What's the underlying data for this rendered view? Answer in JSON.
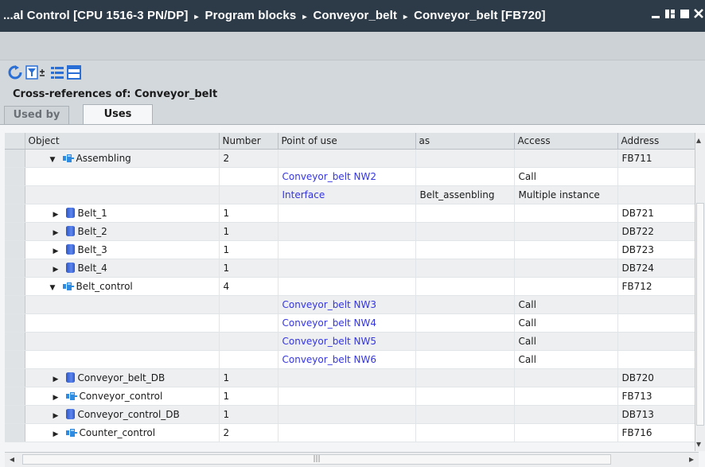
{
  "titlebar": {
    "crumbs": [
      "...al Control [CPU 1516-3 PN/DP]",
      "Program blocks",
      "Conveyor_belt",
      "Conveyor_belt [FB720]"
    ],
    "separator": "▸"
  },
  "toolbar": {
    "icons": [
      "refresh-icon",
      "filter-icon",
      "collapse-icon",
      "layout-icon"
    ]
  },
  "heading": "Cross-references of: Conveyor_belt",
  "tabs": [
    {
      "label": "Used by",
      "active": false
    },
    {
      "label": "Uses",
      "active": true
    }
  ],
  "table": {
    "columns": [
      "Object",
      "Number",
      "Point of use",
      "as",
      "Access",
      "Address"
    ],
    "rows": [
      {
        "kind": "fb",
        "expand": "open",
        "object": "Assembling",
        "number": "2",
        "point": "",
        "as": "",
        "access": "",
        "address": "FB711"
      },
      {
        "kind": "sub",
        "object": "",
        "number": "",
        "point": "Conveyor_belt NW2",
        "as": "",
        "access": "Call",
        "address": ""
      },
      {
        "kind": "sub",
        "object": "",
        "number": "",
        "point": "Interface",
        "as": "Belt_assenbling",
        "access": "Multiple instance",
        "address": ""
      },
      {
        "kind": "db",
        "expand": "closed",
        "object": "Belt_1",
        "number": "1",
        "point": "",
        "as": "",
        "access": "",
        "address": "DB721"
      },
      {
        "kind": "db",
        "expand": "closed",
        "object": "Belt_2",
        "number": "1",
        "point": "",
        "as": "",
        "access": "",
        "address": "DB722"
      },
      {
        "kind": "db",
        "expand": "closed",
        "object": "Belt_3",
        "number": "1",
        "point": "",
        "as": "",
        "access": "",
        "address": "DB723"
      },
      {
        "kind": "db",
        "expand": "closed",
        "object": "Belt_4",
        "number": "1",
        "point": "",
        "as": "",
        "access": "",
        "address": "DB724"
      },
      {
        "kind": "fb",
        "expand": "open",
        "object": "Belt_control",
        "number": "4",
        "point": "",
        "as": "",
        "access": "",
        "address": "FB712"
      },
      {
        "kind": "sub",
        "object": "",
        "number": "",
        "point": "Conveyor_belt NW3",
        "as": "",
        "access": "Call",
        "address": ""
      },
      {
        "kind": "sub",
        "object": "",
        "number": "",
        "point": "Conveyor_belt NW4",
        "as": "",
        "access": "Call",
        "address": ""
      },
      {
        "kind": "sub",
        "object": "",
        "number": "",
        "point": "Conveyor_belt NW5",
        "as": "",
        "access": "Call",
        "address": ""
      },
      {
        "kind": "sub",
        "object": "",
        "number": "",
        "point": "Conveyor_belt NW6",
        "as": "",
        "access": "Call",
        "address": ""
      },
      {
        "kind": "db",
        "expand": "closed",
        "object": "Conveyor_belt_DB",
        "number": "1",
        "point": "",
        "as": "",
        "access": "",
        "address": "DB720"
      },
      {
        "kind": "fb",
        "expand": "closed",
        "object": "Conveyor_control",
        "number": "1",
        "point": "",
        "as": "",
        "access": "",
        "address": "FB713"
      },
      {
        "kind": "db",
        "expand": "closed",
        "object": "Conveyor_control_DB",
        "number": "1",
        "point": "",
        "as": "",
        "access": "",
        "address": "DB713"
      },
      {
        "kind": "fb",
        "expand": "closed",
        "object": "Counter_control",
        "number": "2",
        "point": "",
        "as": "",
        "access": "",
        "address": "FB716"
      }
    ]
  },
  "colors": {
    "titlebar": "#2d3b48",
    "link": "#3535e0",
    "fb_icon": "#2f8be0",
    "db_icon": "#3a62d0"
  }
}
